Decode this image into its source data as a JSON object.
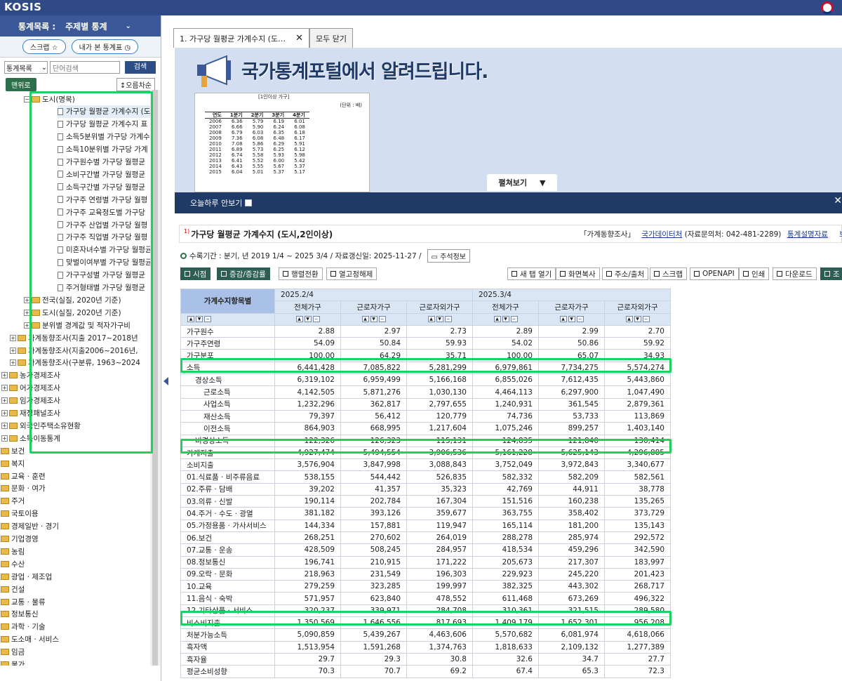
{
  "app": {
    "logo": "KOSIS",
    "emblem_text": "국"
  },
  "left": {
    "header_label": "통계목록 :",
    "header_value": "주제별 통계",
    "scrap_btn": "스크랩 ☆",
    "recent_btn": "내가 본 통계표",
    "search_select": "통계목록",
    "search_placeholder": "단어검색",
    "search_btn": "검색",
    "top_btn": "맨위로",
    "sort_btn": "↕오름차순",
    "tree": [
      {
        "label": "도시(명목)",
        "kind": "folder",
        "pm": "−",
        "indent": 64
      },
      {
        "label": "가구당 월평균 가계수지 (도",
        "kind": "doc",
        "indent": 84,
        "selected": true
      },
      {
        "label": "가구당 월평균 가계수지 표",
        "kind": "doc",
        "indent": 84
      },
      {
        "label": "소득5분위별 가구당 가계수",
        "kind": "doc",
        "indent": 84
      },
      {
        "label": "소득10분위별 가구당 가계",
        "kind": "doc",
        "indent": 84
      },
      {
        "label": "가구원수별 가구당 월평균",
        "kind": "doc",
        "indent": 84
      },
      {
        "label": "소비구간별 가구당 월평균",
        "kind": "doc",
        "indent": 84
      },
      {
        "label": "소득구간별 가구당 월평균",
        "kind": "doc",
        "indent": 84
      },
      {
        "label": "가구주 연령별 가구당 월평",
        "kind": "doc",
        "indent": 84
      },
      {
        "label": "가구주 교육정도별 가구당",
        "kind": "doc",
        "indent": 84
      },
      {
        "label": "가구주 산업별 가구당 월평",
        "kind": "doc",
        "indent": 84
      },
      {
        "label": "가구주 직업별 가구당 월평",
        "kind": "doc",
        "indent": 84
      },
      {
        "label": "미혼자녀수별 가구당 월평균",
        "kind": "doc",
        "indent": 84
      },
      {
        "label": "맞벌이여부별 가구당 월평균",
        "kind": "doc",
        "indent": 84
      },
      {
        "label": "가구구성별 가구당 월평균",
        "kind": "doc",
        "indent": 84
      },
      {
        "label": "주거형태별 가구당 월평균",
        "kind": "doc",
        "indent": 84
      },
      {
        "label": "전국(실질, 2020년 기준)",
        "kind": "folder",
        "pm": "+",
        "indent": 64
      },
      {
        "label": "도시(실질, 2020년 기준)",
        "kind": "folder",
        "pm": "+",
        "indent": 64
      },
      {
        "label": "분위별 경계값 및 적자가구비",
        "kind": "folder",
        "pm": "+",
        "indent": 64
      },
      {
        "label": "가계동향조사(지출 2017~2018년",
        "kind": "folder",
        "pm": "+",
        "indent": 44
      },
      {
        "label": "가계동향조사(지출2006~2016년,",
        "kind": "folder",
        "pm": "+",
        "indent": 44
      },
      {
        "label": "가계동향조사(구분류, 1963~2024",
        "kind": "folder",
        "pm": "+",
        "indent": 44
      },
      {
        "label": "농가경제조사",
        "kind": "folder",
        "pm": "+",
        "indent": 32
      },
      {
        "label": "어가경제조사",
        "kind": "folder",
        "pm": "+",
        "indent": 32
      },
      {
        "label": "임가경제조사",
        "kind": "folder",
        "pm": "+",
        "indent": 32
      },
      {
        "label": "재정패널조사",
        "kind": "folder",
        "pm": "+",
        "indent": 32
      },
      {
        "label": "외국인주택소유현황",
        "kind": "folder",
        "pm": "+",
        "indent": 32
      },
      {
        "label": "소득이동통계",
        "kind": "folder",
        "pm": "+",
        "indent": 32
      },
      {
        "label": "보건",
        "kind": "folder",
        "pm": "+",
        "indent": 20
      },
      {
        "label": "복지",
        "kind": "folder",
        "pm": "+",
        "indent": 20
      },
      {
        "label": "교육 · 훈련",
        "kind": "folder",
        "pm": "+",
        "indent": 20
      },
      {
        "label": "문화 · 여가",
        "kind": "folder",
        "pm": "+",
        "indent": 20
      },
      {
        "label": "주거",
        "kind": "folder",
        "pm": "+",
        "indent": 20
      },
      {
        "label": "국토이용",
        "kind": "folder",
        "pm": "+",
        "indent": 20
      },
      {
        "label": "경제일반 · 경기",
        "kind": "folder",
        "pm": "+",
        "indent": 20
      },
      {
        "label": "기업경영",
        "kind": "folder",
        "pm": "+",
        "indent": 20
      },
      {
        "label": "농림",
        "kind": "folder",
        "pm": "+",
        "indent": 20
      },
      {
        "label": "수산",
        "kind": "folder",
        "pm": "+",
        "indent": 20
      },
      {
        "label": "광업 · 제조업",
        "kind": "folder",
        "pm": "+",
        "indent": 20
      },
      {
        "label": "건설",
        "kind": "folder",
        "pm": "+",
        "indent": 20
      },
      {
        "label": "교통 · 물류",
        "kind": "folder",
        "pm": "+",
        "indent": 20
      },
      {
        "label": "정보통신",
        "kind": "folder",
        "pm": "+",
        "indent": 20
      },
      {
        "label": "과학 · 기술",
        "kind": "folder",
        "pm": "+",
        "indent": 20
      },
      {
        "label": "도소매 · 서비스",
        "kind": "folder",
        "pm": "+",
        "indent": 20
      },
      {
        "label": "임금",
        "kind": "folder",
        "pm": "+",
        "indent": 20
      },
      {
        "label": "물가",
        "kind": "folder",
        "pm": "+",
        "indent": 20
      }
    ]
  },
  "tabs": [
    {
      "label": "1. 가구당 월평균 가계수지 (도…",
      "active": true,
      "close": "✕"
    },
    {
      "label": "모두 닫기",
      "active": false
    }
  ],
  "notice": {
    "title": "국가통계포털에서 알려드립니다.",
    "paper_head": "[1인이상 가구]",
    "paper_unit": "(단위 : 배)",
    "paper_cols": [
      "연도",
      "1분기",
      "2분기",
      "3분기",
      "4분기"
    ],
    "paper_rows": [
      [
        "2006",
        "6.36",
        "5.79",
        "6.19",
        "6.01"
      ],
      [
        "2007",
        "6.66",
        "5.90",
        "6.24",
        "6.08"
      ],
      [
        "2008",
        "6.79",
        "6.03",
        "6.35",
        "6.18"
      ],
      [
        "2009",
        "7.36",
        "6.08",
        "6.48",
        "6.17"
      ],
      [
        "2010",
        "7.08",
        "5.86",
        "6.29",
        "5.91"
      ],
      [
        "2011",
        "6.89",
        "5.73",
        "6.25",
        "6.12"
      ],
      [
        "2012",
        "6.74",
        "5.58",
        "5.93",
        "5.98"
      ],
      [
        "2013",
        "6.41",
        "5.52",
        "6.00",
        "5.42"
      ],
      [
        "2014",
        "6.43",
        "5.55",
        "5.67",
        "5.37"
      ],
      [
        "2015",
        "6.04",
        "5.01",
        "5.37",
        "5.17"
      ]
    ],
    "expand_label": "펼쳐보기",
    "expand_caret": "▼",
    "hide_today": "오늘하루 안보기",
    "close": "✕"
  },
  "table_title": {
    "sup": "1)",
    "title": "가구당 월평균 가계수지 (도시,2인이상)",
    "survey": "「가계동향조사」",
    "source_link": "국가데이터처",
    "source_contact": "(자료문의처: 042-481-2289)",
    "stat_desc": "통계설명자료",
    "more": "보"
  },
  "period": {
    "text": "수록기간 : 분기, 년 2019 1/4 ~ 2025 3/4 / 자료갱신일: 2025-11-27 /",
    "note_btn": "주석정보"
  },
  "toolbar": {
    "left": [
      "시점",
      "증감/증감률",
      "행렬전환",
      "열고정해제"
    ],
    "right": [
      "새 탭 열기",
      "화면복사",
      "주소/출처",
      "스크랩",
      "OPENAPI",
      "인쇄",
      "다운로드",
      "조"
    ]
  },
  "table": {
    "corner": "가계수지항목별",
    "periods": [
      "2025.2/4",
      "2025.3/4"
    ],
    "cols": [
      "전체가구",
      "근로자가구",
      "근로자외가구",
      "전체가구",
      "근로자가구",
      "근로자외가구"
    ],
    "rows": [
      {
        "label": "가구원수",
        "indent": 0,
        "vals": [
          "2.88",
          "2.97",
          "2.73",
          "2.89",
          "2.99",
          "2.70"
        ]
      },
      {
        "label": "가구주연령",
        "indent": 0,
        "vals": [
          "54.09",
          "50.84",
          "59.93",
          "54.02",
          "50.86",
          "59.92"
        ]
      },
      {
        "label": "가구분포",
        "indent": 0,
        "vals": [
          "100.00",
          "64.29",
          "35.71",
          "100.00",
          "65.07",
          "34.93"
        ]
      },
      {
        "label": "소득",
        "indent": 0,
        "vals": [
          "6,441,428",
          "7,085,822",
          "5,281,299",
          "6,979,861",
          "7,734,275",
          "5,574,274"
        ]
      },
      {
        "label": "경상소득",
        "indent": 1,
        "vals": [
          "6,319,102",
          "6,959,499",
          "5,166,168",
          "6,855,026",
          "7,612,435",
          "5,443,860"
        ]
      },
      {
        "label": "근로소득",
        "indent": 2,
        "vals": [
          "4,142,505",
          "5,871,276",
          "1,030,130",
          "4,464,113",
          "6,297,900",
          "1,047,490"
        ]
      },
      {
        "label": "사업소득",
        "indent": 2,
        "vals": [
          "1,232,296",
          "362,817",
          "2,797,655",
          "1,240,931",
          "361,545",
          "2,879,361"
        ]
      },
      {
        "label": "재산소득",
        "indent": 2,
        "vals": [
          "79,397",
          "56,412",
          "120,779",
          "74,736",
          "53,733",
          "113,869"
        ]
      },
      {
        "label": "이전소득",
        "indent": 2,
        "vals": [
          "864,903",
          "668,995",
          "1,217,604",
          "1,075,246",
          "899,257",
          "1,403,140"
        ]
      },
      {
        "label": "비경상소득",
        "indent": 1,
        "vals": [
          "122,326",
          "126,323",
          "115,131",
          "124,835",
          "121,840",
          "130,414"
        ]
      },
      {
        "label": "가계지출",
        "indent": 0,
        "vals": [
          "4,927,474",
          "5,494,554",
          "3,906,536",
          "5,161,228",
          "5,625,143",
          "4,296,885"
        ]
      },
      {
        "label": "소비지출",
        "indent": 0,
        "vals": [
          "3,576,904",
          "3,847,998",
          "3,088,843",
          "3,752,049",
          "3,972,843",
          "3,340,677"
        ]
      },
      {
        "label": "01.식료품 · 비주류음료",
        "indent": 0,
        "vals": [
          "538,155",
          "544,442",
          "526,835",
          "582,332",
          "582,209",
          "582,561"
        ]
      },
      {
        "label": "02.주류 · 담배",
        "indent": 0,
        "vals": [
          "39,202",
          "41,357",
          "35,323",
          "42,769",
          "44,911",
          "38,778"
        ]
      },
      {
        "label": "03.의류 · 신발",
        "indent": 0,
        "vals": [
          "190,114",
          "202,784",
          "167,304",
          "151,516",
          "160,238",
          "135,265"
        ]
      },
      {
        "label": "04.주거 · 수도 · 광열",
        "indent": 0,
        "vals": [
          "381,182",
          "393,126",
          "359,677",
          "363,755",
          "358,402",
          "373,729"
        ]
      },
      {
        "label": "05.가정용품 · 가사서비스",
        "indent": 0,
        "vals": [
          "144,334",
          "157,881",
          "119,947",
          "165,114",
          "181,200",
          "135,143"
        ]
      },
      {
        "label": "06.보건",
        "indent": 0,
        "vals": [
          "268,251",
          "270,602",
          "264,019",
          "288,278",
          "285,974",
          "292,572"
        ]
      },
      {
        "label": "07.교통 · 운송",
        "indent": 0,
        "vals": [
          "428,509",
          "508,245",
          "284,957",
          "418,534",
          "459,296",
          "342,590"
        ]
      },
      {
        "label": "08.정보통신",
        "indent": 0,
        "vals": [
          "196,741",
          "210,915",
          "171,222",
          "205,673",
          "217,307",
          "183,997"
        ]
      },
      {
        "label": "09.오락 · 문화",
        "indent": 0,
        "vals": [
          "218,963",
          "231,549",
          "196,303",
          "229,923",
          "245,220",
          "201,423"
        ]
      },
      {
        "label": "10.교육",
        "indent": 0,
        "vals": [
          "279,259",
          "323,285",
          "199,997",
          "382,325",
          "443,302",
          "268,717"
        ]
      },
      {
        "label": "11.음식 · 숙박",
        "indent": 0,
        "vals": [
          "571,957",
          "623,840",
          "478,552",
          "611,468",
          "673,269",
          "496,322"
        ]
      },
      {
        "label": "12.기타상품 · 서비스",
        "indent": 0,
        "vals": [
          "320,237",
          "339,971",
          "284,708",
          "310,361",
          "321,515",
          "289,580"
        ]
      },
      {
        "label": "비소비지출",
        "indent": 0,
        "vals": [
          "1,350,569",
          "1,646,556",
          "817,693",
          "1,409,179",
          "1,652,301",
          "956,208"
        ]
      },
      {
        "label": "처분가능소득",
        "indent": 0,
        "vals": [
          "5,090,859",
          "5,439,267",
          "4,463,606",
          "5,570,682",
          "6,081,974",
          "4,618,066"
        ]
      },
      {
        "label": "흑자액",
        "indent": 0,
        "vals": [
          "1,513,954",
          "1,591,268",
          "1,374,763",
          "1,818,633",
          "2,109,132",
          "1,277,389"
        ]
      },
      {
        "label": "흑자율",
        "indent": 0,
        "vals": [
          "29.7",
          "29.3",
          "30.8",
          "32.6",
          "34.7",
          "27.7"
        ]
      },
      {
        "label": "평균소비성향",
        "indent": 0,
        "vals": [
          "70.3",
          "70.7",
          "69.2",
          "67.4",
          "65.3",
          "72.3"
        ]
      }
    ]
  },
  "colors": {
    "highlight": "#1fd15e",
    "header_blue": "#2f4a86",
    "accent_green": "#2d5e53"
  }
}
